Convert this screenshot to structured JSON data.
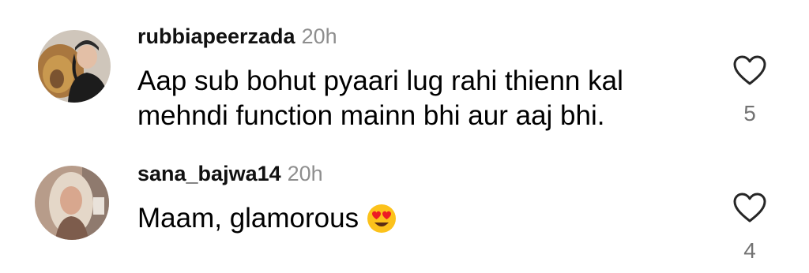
{
  "comments": [
    {
      "username": "rubbiapeerzada",
      "timestamp": "20h",
      "text_lines": [
        "Aap sub bohut pyaari lug rahi thienn kal",
        "mehndi function mainn bhi aur aaj bhi."
      ],
      "like_count": "5",
      "avatar_icon": "avatar-woman-with-lion-photo"
    },
    {
      "username": "sana_bajwa14",
      "timestamp": "20h",
      "text": "Maam, glamorous",
      "emoji": "heart-eyes-emoji",
      "like_count": "4",
      "avatar_icon": "avatar-woman-photo"
    }
  ],
  "icons": {
    "like": "heart-outline-icon"
  },
  "colors": {
    "text": "#000000",
    "username": "#111111",
    "muted": "#8e8e8e",
    "count": "#737373"
  }
}
